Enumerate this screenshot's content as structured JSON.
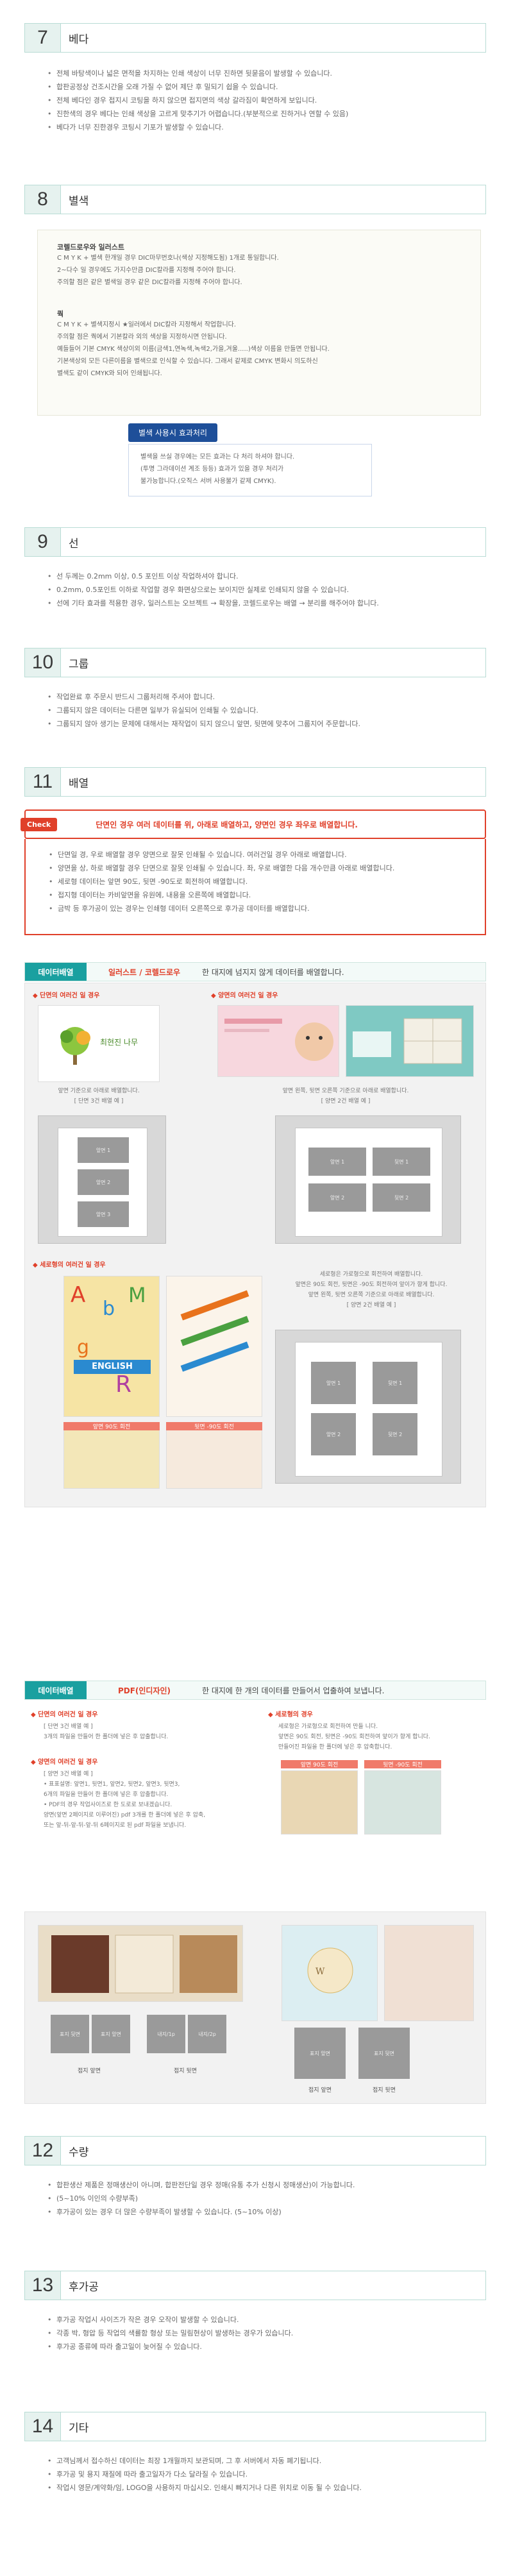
{
  "sections": {
    "s7": {
      "num": "7",
      "title": "베다",
      "bullets": [
        "전체 바탕색이나 넓은 면적을 차지하는 인쇄 색상이 너무 진하면 뒷묻음이 발생할 수 있습니다.",
        "합판공정상 건조시간을 오래 가질 수 없어 제단 후 밀되기 쉽을 수 있습니다.",
        "전체 베다인 경우 접지시 코팅을 하지 않으면 접지면의 색상 갈라짐이 확연하게 보입니다.",
        "진한색의 경우 베다는 인쇄 색상을 고르게 맞추기가 어렵습니다.(부분적으로 진하거나 연할 수 있음)",
        "베다가 너무 진한경우 코팅시 기포가 발생할 수 있습니다."
      ]
    },
    "s8": {
      "num": "8",
      "title": "별색",
      "note1_title": "코렐드로우와 일러스트",
      "note1_lines": [
        "C M Y K + 별색 한개일 경우 DIC마무번호나(색상 지정해도됨) 1개로 통일합니다.",
        "2~다수 일 경우에도 가지수만큼 DIC칼라를 지정해 주어야 합니다.",
        "주의할 점은 같은 별색일 경우 같은 DIC칼라를 지정해 주어야 합니다."
      ],
      "note2_title": "쿽",
      "note2_lines": [
        "C M Y K + 별색지정시 ★일러에서 DIC칼라 지정해서 작업합니다.",
        "주의할 점은 쿽에서 기본칼라 외의 색상을 지정하시면 안됩니다.",
        "예들들어 기본 CMYK 색상이외 이름(금색1,연녹색,녹색2,가을,겨울.....)색상 이름을 만들면 안됩니다.",
        "기본색상외 모든 다른이름을 별색으로 인식할 수 있습니다. 그래서 같제로 CMYK 변화시 의도하신",
        "별색도 같이 CMYK와 되어 인쇄됩니다."
      ],
      "effect_badge": "별색 사용시 효과처리",
      "effect_lines": [
        "별색을 쓰실 경우에는 모든 효과는 다 처리 하셔야 합니다.",
        "(투명 그라데이션 계조 등등) 효과가 있을 경우 처리가",
        "불가능합니다.(오직스 서버 사용불가 같제 CMYK)."
      ]
    },
    "s9": {
      "num": "9",
      "title": "선",
      "bullets": [
        "선 두께는 0.2mm 이상, 0.5 포인트 이상 작업하셔야 합니다.",
        "0.2mm, 0.5포인트 이하로 작업할 경우 화면상으로는 보이지만 실제로 인쇄되지 않을 수 있습니다.",
        "선에 기타 효과를 적용한 경우, 일러스트는 오브젝트 → 확장을, 코렐드로우는 배열 → 분리를 해주어야 합니다."
      ]
    },
    "s10": {
      "num": "10",
      "title": "그룹",
      "bullets": [
        "작업완료 후 주문시 반드시 그룹처리해 주셔야 합니다.",
        "그룹되지 않은 데이터는 다른면 일부가 유실되어 인쇄될 수 있습니다.",
        "그룹되지 않아 생기는 문제에 대해서는 재작업이 되지 않으니 앞면, 뒷면에 맞추어 그룹지어 주문합니다."
      ]
    },
    "s11": {
      "num": "11",
      "title": "배열",
      "check_label": "Check",
      "check_text": "단면인 경우 여러 데이터를 위, 아래로 배열하고, 양면인 경우 좌우로 배열합니다.",
      "bullets": [
        "단면일 경, 우로 배열할 경우 양면으로 잘못 인쇄될 수 있습니다. 여러건일 경우 아래로 배열합니다.",
        "양면을 상, 하로 배열할 경우 단면으로 잘못 인쇄될 수 있습니다. 좌, 우로 배열한 다음 개수만큼 아래로 배열합니다.",
        "세로형 데이터는 앞면 90도, 뒷면 -90도로 회전하여 배열합니다.",
        "접지형 데이터는 카비앞면을 유원에, 내용을 오른쪽에 배열합니다.",
        "금박 등 후가공이 있는 경우는 인쇄형 데이터 오른쪽으로 후가공 데이터를 배열합니다."
      ]
    },
    "layout1": {
      "tag": "데이터배열",
      "kind": "일러스트 / 코렐드로우",
      "desc": "한 대지에 넘지지 않게 데이터를 배열합니다.",
      "single_title": "◆ 단면의 여러건 일 경우",
      "single_caption": "앞면 기준으로 아래로 배열합니다.",
      "single_caption2": "[ 단면 3건 배열 예 ]",
      "single_brand": "최현진 나무",
      "single_slots": [
        "앞면 1",
        "앞면 2",
        "앞면 3"
      ],
      "double_title": "◆ 양면의 여러건 일 경우",
      "double_caption": "앞면 왼쪽, 뒷면 오른쪽 기준으로 아래로 배열합니다.",
      "double_caption2": "[ 양면 2건 배열 예 ]",
      "double_slots": [
        "앞면 1",
        "뒷면 1",
        "앞면 2",
        "뒷면 2"
      ],
      "vertical_title": "◆ 세로형의 여러건 일 경우",
      "vertical_lines": [
        "세로형은 가로형으로 회전하여 배열합니다.",
        "앞면은 90도 회전, 뒷면은 -90도 회전하여 앞이가 향게 합니다.",
        "앞면 왼쪽, 뒷면 오른쪽 기준으로 아래로 배열합니다.",
        "[ 양면 2건 배열 예 ]"
      ],
      "vertical_art_labels": [
        "앞면 90도 회전",
        "뒷면 -90도 회전"
      ],
      "vertical_slots": [
        "앞면 1",
        "뒷면 1",
        "앞면 2",
        "뒷면 2"
      ],
      "english_word": "ENGLISH"
    },
    "layout2": {
      "tag": "데이터배열",
      "kind": "PDF(인디자인)",
      "desc": "한 대지에 한 개의 데이터를 만들어서 업출하여 보냅니다.",
      "single_title": "◆ 단면의 여러건 일 경우",
      "single_lines": [
        "[ 단면 3건 배열 예 ]",
        "3개의 파일을 만들어 한 폴더에 넣은 후 압출합니다."
      ],
      "double_title": "◆ 양면의 여러건 일 경우",
      "double_lines": [
        "[ 양면 3건 배열 예 ]",
        "• 표표설명: 앞면1, 뒷면1, 앞면2, 뒷면2, 앞면3, 뒷면3,",
        "6개의 파일을 만들어 한 폴더에 넣은 후 압출합니다.",
        "• PDF의 경우 작업사이즈로 한 도로로 보내겠습니다.",
        "양면(앞면 2페이지로 이루어진) pdf 3개를 한 폴더에 넣은 후 압축,",
        "또는 앞-뒤-앞-뒤-앞-뒤 6페이지로 된 pdf 파일을 보냅니다."
      ],
      "vertical_title": "◆ 세로형의 경우",
      "vertical_lines": [
        "세로형은 가로형으로 회전하여 만들 니다.",
        "앞면은 90도 회전, 뒷면은 -90도 회전하여 앞이가 향게 합니다.",
        "만들어진 파일을 한 폴더에 넣은 후 압축합니다."
      ],
      "vertical_art_labels": [
        "앞면 90도 회전",
        "뒷면 -90도 회전"
      ],
      "gallery_labels": [
        "표지앞면",
        "표지뒷면",
        "내지"
      ],
      "slot_labels_a": [
        "표지 뒷면",
        "표지 앞면",
        "내지/1p",
        "내지/2p"
      ],
      "slot_labels_b": [
        "표지 앞면",
        "표지 뒷면",
        "내지/1p",
        "내지/2p"
      ],
      "captions": [
        "접지 앞면",
        "접지 뒷면",
        "접지 앞면",
        "접지 뒷면"
      ]
    },
    "s12": {
      "num": "12",
      "title": "수량",
      "bullets": [
        "합판생산 제품은 정매생산이 아니며, 합판전단일 경우 정매(유통 추가 신청시 정매생산)이 가능합니다.",
        "(5~10% 이인의 수량부족)",
        "후가공이 있는 경우 더 많은 수량부족이 발생할 수 있습니다. (5~10% 이상)"
      ]
    },
    "s13": {
      "num": "13",
      "title": "후가공",
      "bullets": [
        "후가공 작업시 사이즈가 작은 경우 오작이 발생할 수 있습니다.",
        "각종 박, 형압 등 작업의 색률함 형상 또는 밀림현상이 발생하는 경우가 있습니다.",
        "후가공 종류에 따라 출고일이 늦어질 수 있습니다."
      ]
    },
    "s14": {
      "num": "14",
      "title": "기타",
      "bullets": [
        "고객님께서 접수하신 데이터는 최장 1개월까지 보관되며, 그 후 서버에서 자동 폐기됩니다.",
        "후가공 및 용지 재질에 따라 출고일자가 다소 달라질 수 있습니다.",
        "작업시 영문/계약화/임, LOGO을 사용하지 마십시오. 인쇄시 빠지거나 다른 위치로 이동 될 수 있습니다."
      ]
    }
  },
  "colors": {
    "accent": "#1aa0a0",
    "red": "#e0402a",
    "head_bg": "#e6f2ef",
    "badge": "#1e4f99"
  }
}
